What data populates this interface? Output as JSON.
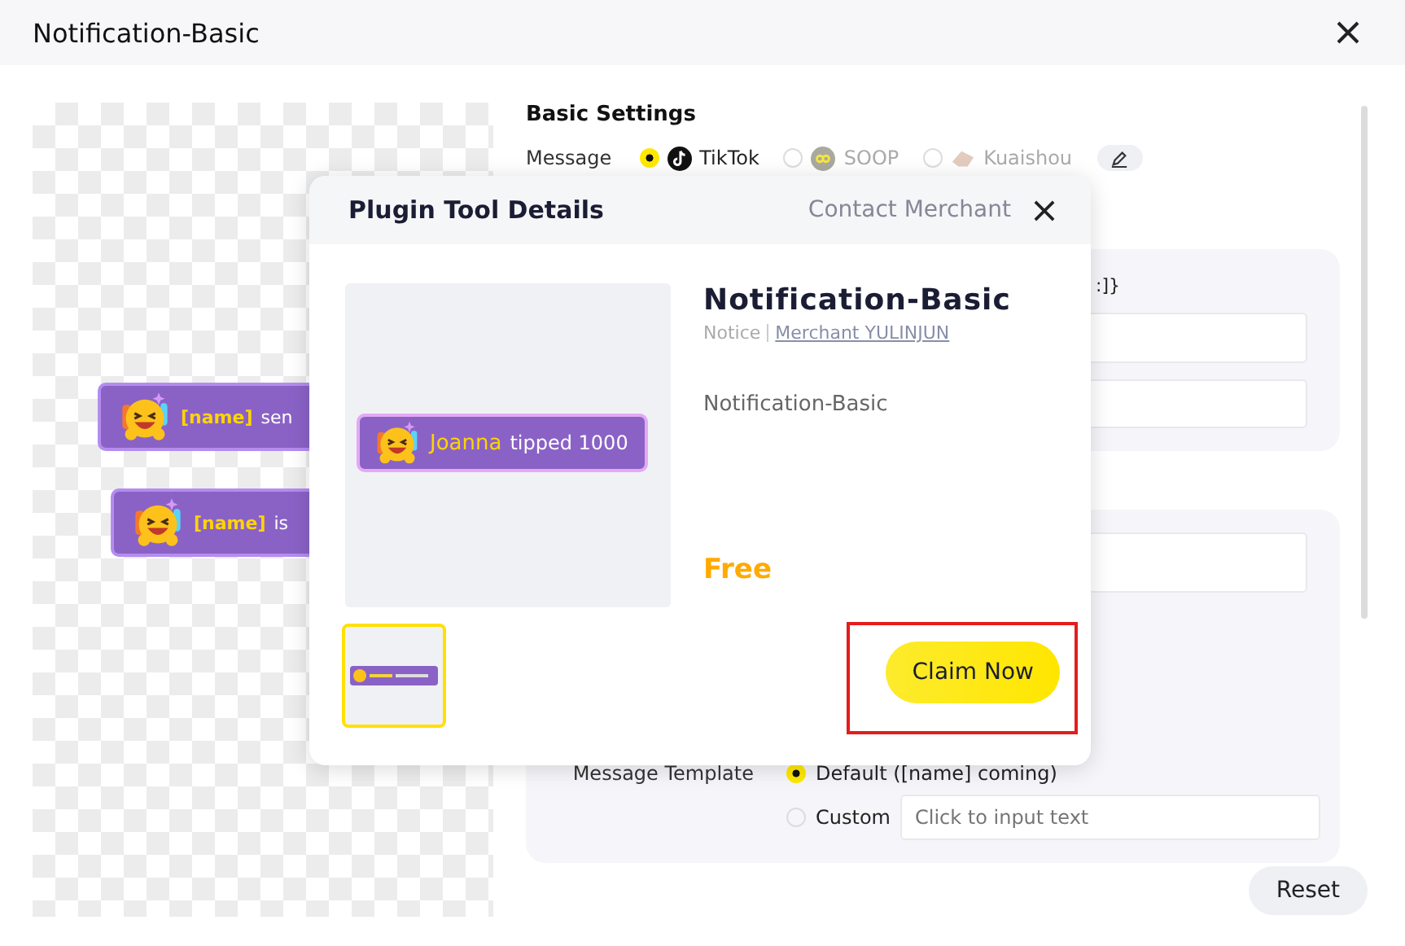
{
  "window": {
    "title": "Notification-Basic"
  },
  "preview": {
    "banners": [
      {
        "name": "[name]",
        "text": "sen"
      },
      {
        "name": "[name]",
        "text": "is"
      }
    ]
  },
  "settings": {
    "title": "Basic Settings",
    "message_label": "Message",
    "platforms": [
      {
        "label": "TikTok",
        "selected": true
      },
      {
        "label": "SOOP",
        "selected": false
      },
      {
        "label": "Kuaishou",
        "selected": false
      }
    ],
    "hint_fragment": ":]}",
    "template_label": "Message Template",
    "template_options": [
      {
        "label": "Default ([name] coming)",
        "selected": true
      },
      {
        "label": "Custom",
        "selected": false
      }
    ],
    "custom_placeholder": "Click to input text",
    "reset": "Reset"
  },
  "modal": {
    "title": "Plugin Tool Details",
    "contact": "Contact Merchant",
    "name": "Notification-Basic",
    "category": "Notice",
    "merchant": "Merchant YULINJUN",
    "description": "Notification-Basic",
    "price": "Free",
    "banner": {
      "name": "Joanna",
      "text": "tipped 1000"
    },
    "thumbnails": [
      {
        "selected": true
      }
    ],
    "claim": "Claim Now",
    "claim_highlighted": true
  }
}
